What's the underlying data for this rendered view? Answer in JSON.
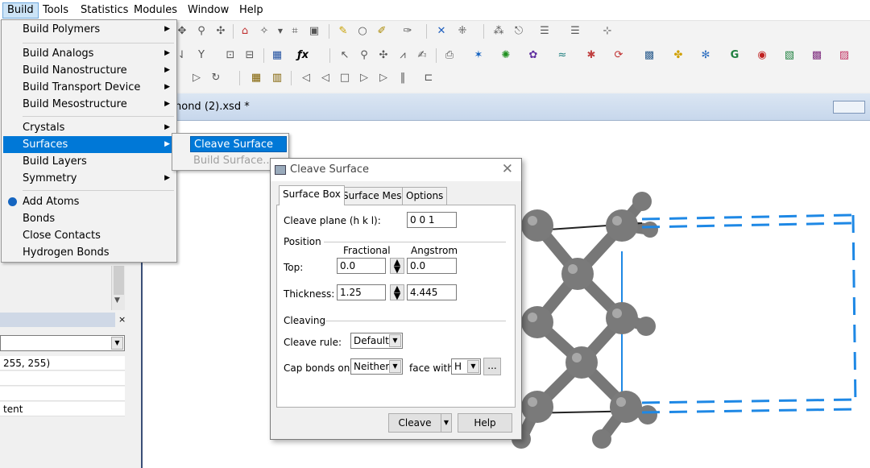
{
  "menubar": {
    "items": [
      "Build",
      "Tools",
      "Statistics",
      "Modules",
      "Window",
      "Help"
    ],
    "active_index": 0
  },
  "build_menu": {
    "items": [
      {
        "label": "Build Polymers",
        "submenu": true
      },
      {
        "label": "Build Analogs",
        "submenu": true
      },
      {
        "label": "Build Nanostructure",
        "submenu": true
      },
      {
        "label": "Build Transport Device",
        "submenu": true
      },
      {
        "label": "Build Mesostructure",
        "submenu": true
      },
      {
        "label": "Crystals",
        "submenu": true
      },
      {
        "label": "Surfaces",
        "submenu": true,
        "highlighted": true
      },
      {
        "label": "Build Layers",
        "submenu": false
      },
      {
        "label": "Symmetry",
        "submenu": true
      },
      {
        "label": "Add Atoms",
        "submenu": false,
        "icon": "add-atoms-icon"
      },
      {
        "label": "Bonds",
        "submenu": false
      },
      {
        "label": "Close Contacts",
        "submenu": false
      },
      {
        "label": "Hydrogen Bonds",
        "submenu": false
      }
    ]
  },
  "surfaces_submenu": {
    "items": [
      {
        "label": "Cleave Surface",
        "highlighted": true,
        "enabled": true
      },
      {
        "label": "Build Surface...",
        "highlighted": false,
        "enabled": false
      }
    ]
  },
  "document": {
    "tab_title": "nond (2).xsd *"
  },
  "left_panel": {
    "color_value": "255, 255)",
    "row_text": "tent"
  },
  "dialog": {
    "title": "Cleave Surface",
    "tabs": [
      "Surface Box",
      "Surface Mesh",
      "Options"
    ],
    "active_tab": 0,
    "cleave_plane_label": "Cleave plane (h k l):",
    "cleave_plane_value": "0  0  1",
    "position_group": "Position",
    "col_fractional": "Fractional",
    "col_angstrom": "Angstrom",
    "top_label": "Top:",
    "top_fractional": "0.0",
    "top_angstrom": "0.0",
    "thickness_label": "Thickness:",
    "thickness_fractional": "1.25",
    "thickness_angstrom": "4.445",
    "cleaving_group": "Cleaving",
    "cleave_rule_label": "Cleave rule:",
    "cleave_rule_value": "Default",
    "cap_bonds_label": "Cap bonds on",
    "cap_bonds_value": "Neither",
    "face_with_label": "face with",
    "face_with_value": "H",
    "browse_label": "...",
    "cleave_button": "Cleave",
    "help_button": "Help"
  },
  "colors": {
    "menu_highlight": "#0078d7",
    "box_outline": "#1e88e5",
    "atom": "#7a7a7a"
  }
}
